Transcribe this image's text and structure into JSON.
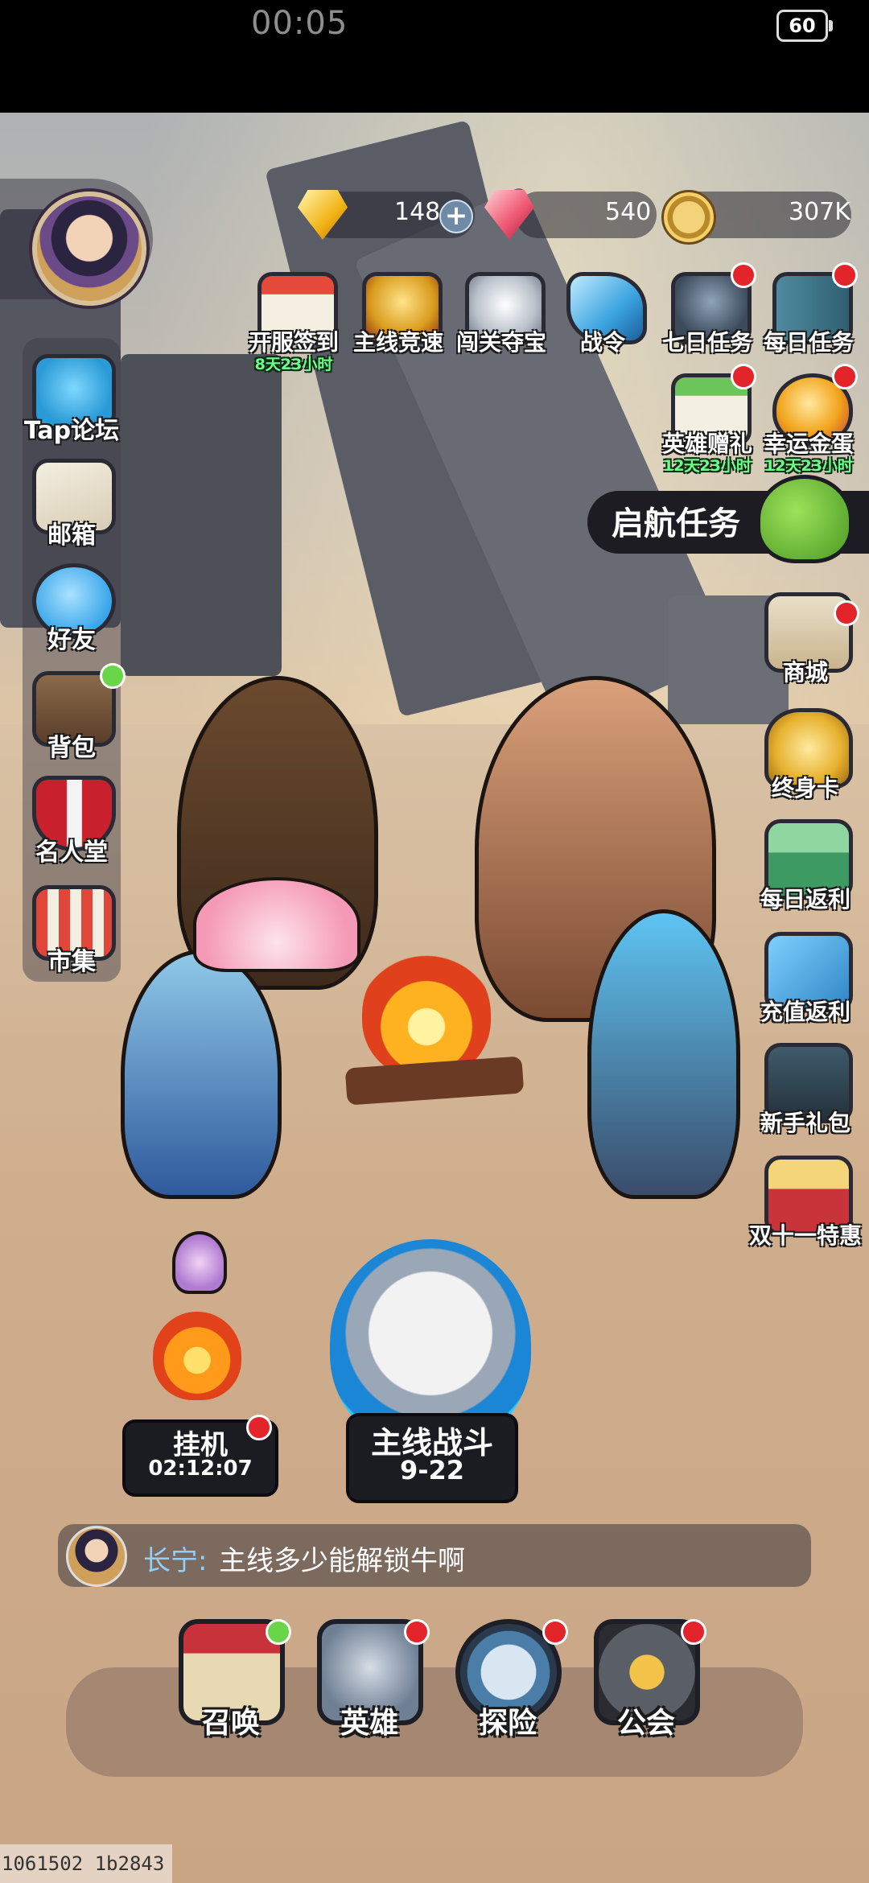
{
  "status_bar": {
    "time": "00:05",
    "battery": "60"
  },
  "currency": {
    "diamond": "148",
    "ruby": "540",
    "gold": "307K"
  },
  "top_events": [
    {
      "label": "开服签到",
      "sub": "8天23小时",
      "icon": "calendar-icon",
      "badge": ""
    },
    {
      "label": "主线竞速",
      "sub": "",
      "icon": "trophy-icon",
      "badge": ""
    },
    {
      "label": "闯关夺宝",
      "sub": "",
      "icon": "wolf-mask-icon",
      "badge": ""
    },
    {
      "label": "战令",
      "sub": "",
      "icon": "scroll-icon",
      "badge": ""
    },
    {
      "label": "七日任务",
      "sub": "",
      "icon": "helmet-icon",
      "badge": "red"
    },
    {
      "label": "每日任务",
      "sub": "",
      "icon": "book-icon",
      "badge": "red"
    }
  ],
  "second_events": [
    {
      "label": "英雄赠礼",
      "sub": "12天23小时",
      "icon": "calendar-gift-icon",
      "badge": "red"
    },
    {
      "label": "幸运金蛋",
      "sub": "12天23小时",
      "icon": "golden-egg-icon",
      "badge": "red"
    }
  ],
  "quest_banner": {
    "label": "启航任务"
  },
  "left_menu": [
    {
      "label": "Tap论坛",
      "icon": "chat-bubble-icon",
      "badge": ""
    },
    {
      "label": "邮箱",
      "icon": "mail-icon",
      "badge": ""
    },
    {
      "label": "好友",
      "icon": "friends-icon",
      "badge": ""
    },
    {
      "label": "背包",
      "icon": "backpack-icon",
      "badge": "green"
    },
    {
      "label": "名人堂",
      "icon": "shield-icon",
      "badge": ""
    },
    {
      "label": "市集",
      "icon": "market-icon",
      "badge": ""
    }
  ],
  "right_menu": [
    {
      "label": "商城",
      "icon": "shop-bag-icon",
      "badge": "red"
    },
    {
      "label": "终身卡",
      "icon": "crown-icon",
      "badge": ""
    },
    {
      "label": "每日返利",
      "icon": "gift-box-icon",
      "badge": ""
    },
    {
      "label": "充值返利",
      "icon": "match-ticket-icon",
      "badge": ""
    },
    {
      "label": "新手礼包",
      "icon": "treasure-chest-icon",
      "badge": ""
    },
    {
      "label": "双十一特惠",
      "icon": "popcorn-gift-icon",
      "badge": ""
    }
  ],
  "idle": {
    "label": "挂机",
    "timer": "02:12:07",
    "icon": "flame-icon"
  },
  "main_battle": {
    "label": "主线战斗",
    "stage": "9-22",
    "icon": "wolf-emblem-icon"
  },
  "chat": {
    "name": "长宁:",
    "message": "主线多少能解锁牛啊"
  },
  "bottom_nav": [
    {
      "label": "召唤",
      "icon": "summon-book-icon",
      "badge": "green"
    },
    {
      "label": "英雄",
      "icon": "hero-helmet-icon",
      "badge": "red"
    },
    {
      "label": "探险",
      "icon": "compass-icon",
      "badge": "red"
    },
    {
      "label": "公会",
      "icon": "guild-badge-icon",
      "badge": "red"
    }
  ],
  "debug_text": "1061502 1b2843",
  "colors": {
    "badge_red": "#e3242b",
    "badge_green": "#6bd54a",
    "timer_green": "#6bff8a",
    "chat_name": "#8fd0ff"
  }
}
